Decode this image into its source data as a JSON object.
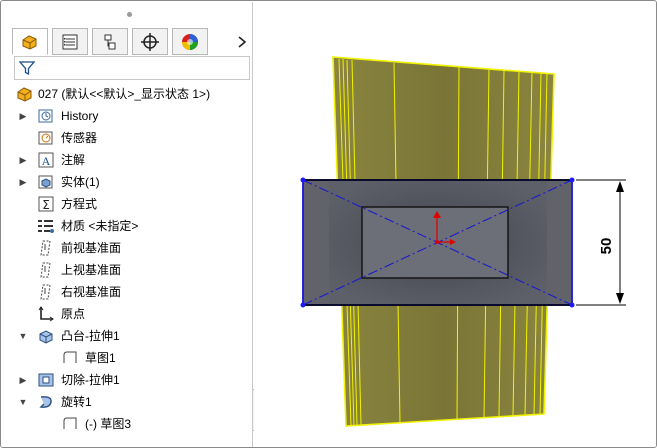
{
  "feature_manager": {
    "tabs": [
      {
        "name": "feature-manager-tab",
        "icon": "part-icon"
      },
      {
        "name": "property-manager-tab",
        "icon": "property-icon"
      },
      {
        "name": "configuration-manager-tab",
        "icon": "configuration-icon"
      },
      {
        "name": "dimxpert-manager-tab",
        "icon": "crosshair-icon"
      },
      {
        "name": "display-manager-tab",
        "icon": "appearance-icon"
      }
    ],
    "more_tabs_icon": "chevron-right-icon",
    "filter_icon": "filter-icon",
    "tree": {
      "root_label": "027  (默认<<默认>_显示状态 1>)",
      "items": [
        {
          "label": "History",
          "icon": "history-icon",
          "expandable": true
        },
        {
          "label": "传感器",
          "icon": "sensor-icon",
          "expandable": false
        },
        {
          "label": "注解",
          "icon": "annotation-icon",
          "expandable": true
        },
        {
          "label": "实体(1)",
          "icon": "solid-body-icon",
          "expandable": true
        },
        {
          "label": "方程式",
          "icon": "equation-icon",
          "expandable": false
        },
        {
          "label": "材质 <未指定>",
          "icon": "material-icon",
          "expandable": false
        },
        {
          "label": "前视基准面",
          "icon": "plane-icon",
          "expandable": false
        },
        {
          "label": "上视基准面",
          "icon": "plane-icon",
          "expandable": false
        },
        {
          "label": "右视基准面",
          "icon": "plane-icon",
          "expandable": false
        },
        {
          "label": "原点",
          "icon": "origin-icon",
          "expandable": false
        },
        {
          "label": "凸台-拉伸1",
          "icon": "boss-extrude-icon",
          "expandable": true,
          "expanded": true
        },
        {
          "label": "草图1",
          "icon": "sketch-icon",
          "child": true
        },
        {
          "label": "切除-拉伸1",
          "icon": "cut-extrude-icon",
          "expandable": true
        },
        {
          "label": "旋转1",
          "icon": "revolve-icon",
          "expandable": true,
          "expanded": true
        },
        {
          "label": "(-) 草图3",
          "icon": "sketch-icon",
          "child": true
        }
      ]
    }
  },
  "viewport": {
    "dimension_label": "50",
    "colors": {
      "part_fill": "#7f7a3e",
      "highlight_edge": "#f2f200",
      "sketch_line": "#1a1aff",
      "centerline": "#1a1acc",
      "dimension": "#000000",
      "origin_x": "#e00000",
      "origin_y": "#e00000"
    }
  }
}
